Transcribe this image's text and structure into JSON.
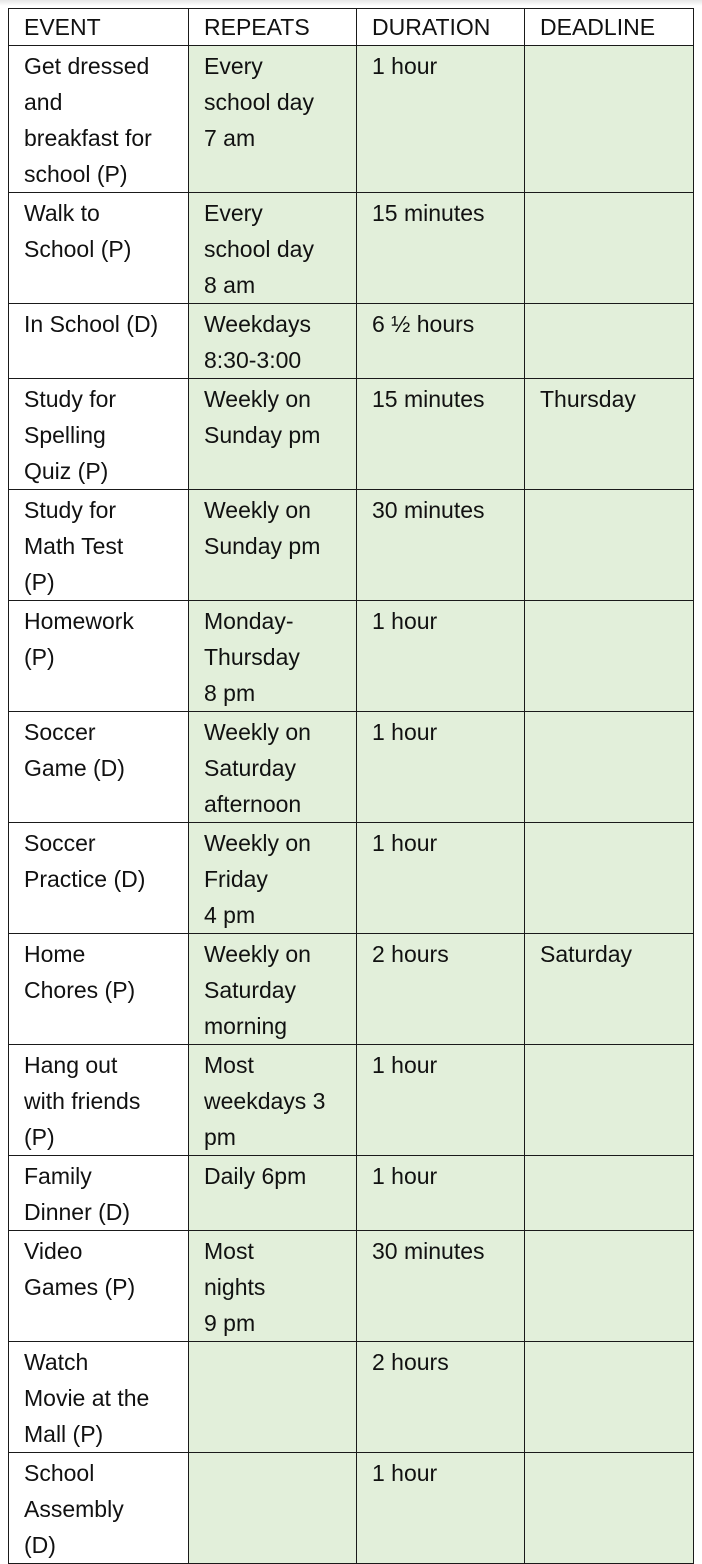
{
  "table": {
    "headers": [
      "EVENT",
      "REPEATS",
      "DURATION",
      "DEADLINE"
    ],
    "rows": [
      {
        "event": "Get dressed\nand\nbreakfast for\nschool (P)",
        "repeats": "Every\nschool day\n7 am",
        "duration": "1 hour",
        "deadline": ""
      },
      {
        "event": "Walk to\nSchool (P)",
        "repeats": "Every\nschool day\n8 am",
        "duration": "15 minutes",
        "deadline": ""
      },
      {
        "event": "In School (D)",
        "repeats": "Weekdays\n8:30-3:00",
        "duration": "6 ½ hours",
        "deadline": ""
      },
      {
        "event": "Study for\nSpelling\nQuiz (P)",
        "repeats": "Weekly on\nSunday pm",
        "duration": "15 minutes",
        "deadline": "Thursday"
      },
      {
        "event": "Study for\nMath Test\n(P)",
        "repeats": "Weekly on\nSunday pm",
        "duration": "30 minutes",
        "deadline": ""
      },
      {
        "event": "Homework\n(P)",
        "repeats": "Monday-\nThursday\n8 pm",
        "duration": "1 hour",
        "deadline": ""
      },
      {
        "event": "Soccer\nGame (D)",
        "repeats": "Weekly on\nSaturday\nafternoon",
        "duration": "1 hour",
        "deadline": ""
      },
      {
        "event": "Soccer\nPractice (D)",
        "repeats": "Weekly on\nFriday\n4 pm",
        "duration": "1 hour",
        "deadline": ""
      },
      {
        "event": "Home\nChores (P)",
        "repeats": "Weekly on\nSaturday\nmorning",
        "duration": "2 hours",
        "deadline": "Saturday"
      },
      {
        "event": "Hang out\nwith friends\n(P)",
        "repeats": "Most\nweekdays 3\npm",
        "duration": "1 hour",
        "deadline": ""
      },
      {
        "event": "Family\nDinner (D)",
        "repeats": "Daily 6pm",
        "duration": "1 hour",
        "deadline": ""
      },
      {
        "event": "Video\nGames (P)",
        "repeats": "Most\nnights\n9 pm",
        "duration": "30 minutes",
        "deadline": ""
      },
      {
        "event": "Watch\nMovie at the\nMall (P)",
        "repeats": "",
        "duration": "2 hours",
        "deadline": ""
      },
      {
        "event": "School\nAssembly\n(D)",
        "repeats": "",
        "duration": "1 hour",
        "deadline": ""
      }
    ]
  },
  "colors": {
    "event_column_bg": "#ffffff",
    "data_columns_bg": "#e2efda",
    "border": "#1a1a1a"
  }
}
